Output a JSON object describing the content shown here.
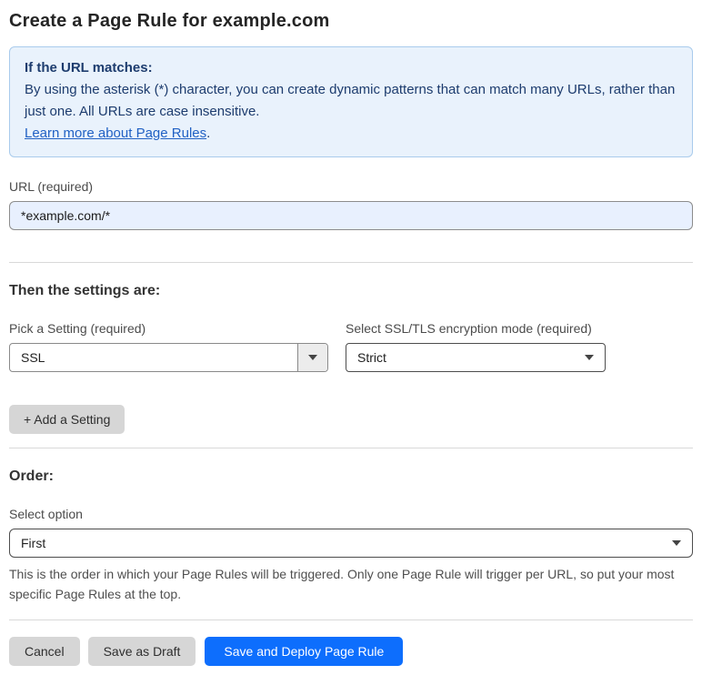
{
  "page": {
    "title": "Create a Page Rule for example.com"
  },
  "info_box": {
    "heading": "If the URL matches:",
    "body": "By using the asterisk (*) character, you can create dynamic patterns that can match many URLs, rather than just one. All URLs are case insensitive.",
    "link_label": "Learn more about Page Rules",
    "link_suffix": "."
  },
  "url_field": {
    "label": "URL (required)",
    "value": "*example.com/*"
  },
  "settings_section": {
    "heading": "Then the settings are:",
    "pick_setting": {
      "label": "Pick a Setting (required)",
      "selected": "SSL"
    },
    "ssl_mode": {
      "label": "Select SSL/TLS encryption mode (required)",
      "selected": "Strict"
    },
    "add_setting_button": "+ Add a Setting"
  },
  "order_section": {
    "heading": "Order:",
    "select_label": "Select option",
    "selected": "First",
    "help_text": "This is the order in which your Page Rules will be triggered. Only one Page Rule will trigger per URL, so put your most specific Page Rules at the top."
  },
  "footer": {
    "cancel_label": "Cancel",
    "save_draft_label": "Save as Draft",
    "save_deploy_label": "Save and Deploy Page Rule"
  },
  "icons": {
    "dropdown_arrow": "caret-down"
  },
  "colors": {
    "accent_blue": "#0d6efd",
    "info_box_bg": "#e9f2fc",
    "info_box_border": "#a9cbec",
    "info_box_text": "#1d3c6e",
    "link_blue": "#2161c4",
    "input_autofill_bg": "#e8f0fe",
    "gray_button_bg": "#d6d6d6",
    "divider": "#d9d9d9"
  }
}
